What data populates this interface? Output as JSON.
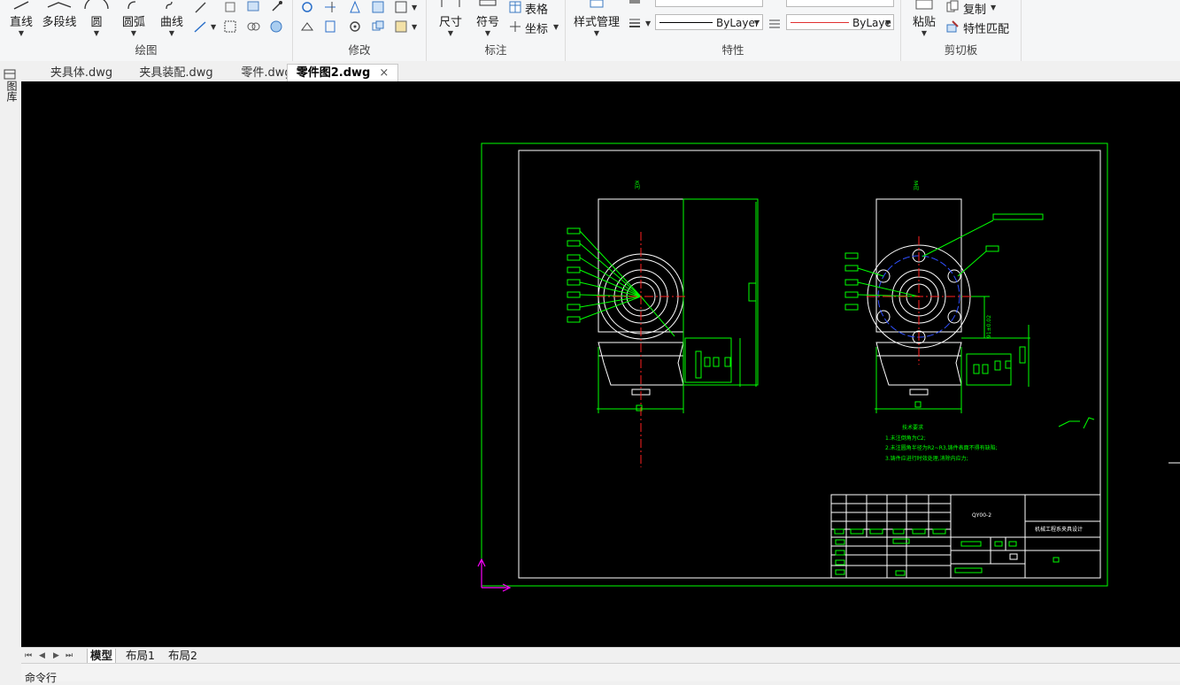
{
  "ribbon": {
    "draw": {
      "group_label": "绘图",
      "line": "直线",
      "polyline": "多段线",
      "circle": "圆",
      "arc": "圆弧",
      "curve": "曲线"
    },
    "modify": {
      "group_label": "修改"
    },
    "annotation": {
      "group_label": "标注",
      "dimension": "尺寸",
      "symbol": "符号",
      "table": "表格",
      "coordinate": "坐标"
    },
    "style": {
      "label": "样式管理"
    },
    "properties": {
      "group_label": "特性",
      "linetype_value": "ByLayer",
      "color_value": "ByLaye",
      "color_swatch": "#e03030"
    },
    "clipboard": {
      "group_label": "剪切板",
      "paste": "粘贴",
      "copy": "复制",
      "match_properties": "特性匹配"
    }
  },
  "side_panel": {
    "label": "图库"
  },
  "tabs": [
    {
      "label": "夹具体.dwg",
      "active": false
    },
    {
      "label": "夹具装配.dwg",
      "active": false
    },
    {
      "label": "零件.dwg",
      "active": false
    },
    {
      "label": "零件图2.dwg",
      "active": true,
      "close": "×"
    }
  ],
  "drawing": {
    "view_label_left": "K向",
    "view_label_right": "M向",
    "dim_text": "91±0.02",
    "notes_title": "技术要求",
    "notes": [
      "1.未注倒角为C2;",
      "2.未注圆角半径为R2~R3,铸件表面不得有缺陷;",
      "3.铸件应进行时效处理,消除内应力;"
    ],
    "title_block_code": "QY00-2",
    "title_block_name": "机械工程系夹具设计",
    "line_color": "#00ff00",
    "center_color": "#ff2020",
    "ucs_color": "#ff00ff"
  },
  "layout_tabs": {
    "nav": [
      "⏮",
      "◀",
      "▶",
      "⏭"
    ],
    "model": "模型",
    "layout1": "布局1",
    "layout2": "布局2"
  },
  "command": {
    "label": "命令行"
  }
}
